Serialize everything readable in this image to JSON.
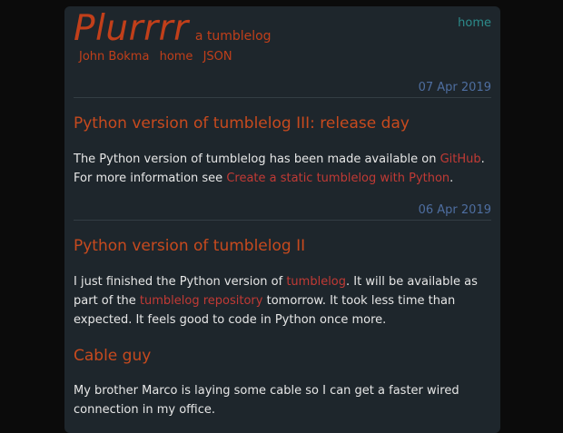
{
  "site": {
    "name": "Plurrrr",
    "tagline": "a tumblelog",
    "top_link": "home",
    "nav": [
      "John Bokma",
      "home",
      "JSON"
    ]
  },
  "days": [
    {
      "date": "07 Apr 2019",
      "posts": [
        {
          "title": "Python version of tumblelog III: release day",
          "body": [
            "The Python version of tumblelog has been made available on ",
            "GitHub",
            ".",
            "For more information see ",
            "Create a static tumblelog with Python",
            "."
          ]
        }
      ]
    },
    {
      "date": "06 Apr 2019",
      "posts": [
        {
          "title": "Python version of tumblelog II",
          "body": [
            "I just finished the Python version of ",
            "tumblelog",
            ". It will be available as part of the ",
            "tumblelog repository",
            " tomorrow. It took less time than expected. It feels good to code in Python once more."
          ]
        },
        {
          "title": "Cable guy",
          "body": [
            "My brother Marco is laying some cable so I can get a faster wired connection in my office."
          ]
        }
      ]
    }
  ],
  "colors": {
    "background": "#0b0b0b",
    "panel": "#1e262c",
    "accent": "#c13f1a",
    "link": "#c13a35",
    "date": "#4e6ea0",
    "top_link": "#2c8c8c",
    "text": "#e6e6e6"
  }
}
